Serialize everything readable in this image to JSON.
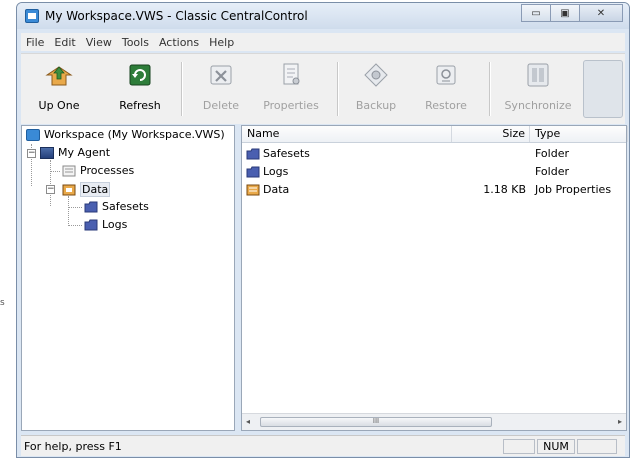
{
  "window": {
    "title": "My Workspace.VWS - Classic CentralControl",
    "buttons": {
      "minimize": "▭",
      "maximize": "▣",
      "close": "✕"
    }
  },
  "menu": [
    "File",
    "Edit",
    "View",
    "Tools",
    "Actions",
    "Help"
  ],
  "toolbar": {
    "up_one": "Up One",
    "refresh": "Refresh",
    "delete": "Delete",
    "properties": "Properties",
    "backup": "Backup",
    "restore": "Restore",
    "synchronize": "Synchronize"
  },
  "tree": {
    "root": "Workspace (My Workspace.VWS)",
    "agent": "My Agent",
    "processes": "Processes",
    "data": "Data",
    "safesets": "Safesets",
    "logs": "Logs",
    "expander_minus": "−"
  },
  "list": {
    "columns": {
      "name": "Name",
      "size": "Size",
      "type": "Type"
    },
    "rows": [
      {
        "name": "Safesets",
        "size": "",
        "type": "Folder",
        "icon": "folder-icon"
      },
      {
        "name": "Logs",
        "size": "",
        "type": "Folder",
        "icon": "folder-icon"
      },
      {
        "name": "Data",
        "size": "1.18 KB",
        "type": "Job Properties",
        "icon": "job-properties-icon"
      }
    ],
    "scroll_left": "◂",
    "scroll_right": "▸",
    "thumb_grip": "III"
  },
  "status": {
    "help_text": "For help, press F1",
    "num": "NUM"
  },
  "colors": {
    "folder": "#4a5fb0",
    "accent": "#3a8ad6"
  }
}
